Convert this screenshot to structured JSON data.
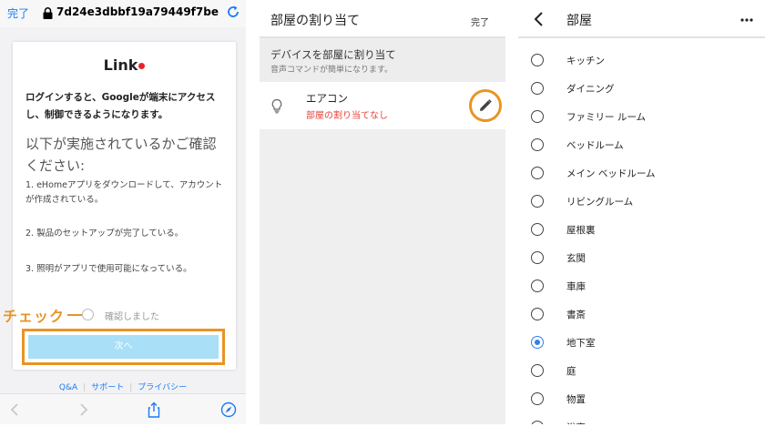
{
  "browser": {
    "done_label": "完了",
    "url": "7d24e3dbbf19a79449f7beaf9",
    "card": {
      "logo_text": "Link",
      "intro": "ログインすると、Googleが端末にアクセスし、制御できるようになります。",
      "confirm_heading": "以下が実施されているかご確認ください:",
      "items": [
        "1. eHomeアプリをダウンロードして、アカウントが作成されている。",
        "2. 製品のセットアップが完了している。",
        "3. 照明がアプリで使用可能になっている。"
      ],
      "checkbox_label": "確認しました",
      "next_label": "次へ"
    },
    "footer_links": [
      "Q&A",
      "サポート",
      "プライバシー"
    ],
    "annotation": "チェック"
  },
  "room_assign": {
    "title": "部屋の割り当て",
    "done_label": "完了",
    "section_title": "デバイスを部屋に割り当て",
    "section_subtitle": "音声コマンドが簡単になります。",
    "device": {
      "name": "エアコン",
      "status": "部屋の割り当てなし"
    }
  },
  "rooms": {
    "title": "部屋",
    "items": [
      {
        "label": "キッチン",
        "selected": false
      },
      {
        "label": "ダイニング",
        "selected": false
      },
      {
        "label": "ファミリー ルーム",
        "selected": false
      },
      {
        "label": "ベッドルーム",
        "selected": false
      },
      {
        "label": "メイン ベッドルーム",
        "selected": false
      },
      {
        "label": "リビングルーム",
        "selected": false
      },
      {
        "label": "屋根裏",
        "selected": false
      },
      {
        "label": "玄関",
        "selected": false
      },
      {
        "label": "車庫",
        "selected": false
      },
      {
        "label": "書斎",
        "selected": false
      },
      {
        "label": "地下室",
        "selected": true
      },
      {
        "label": "庭",
        "selected": false
      },
      {
        "label": "物置",
        "selected": false
      },
      {
        "label": "浴室",
        "selected": false
      }
    ]
  },
  "colors": {
    "accent_blue": "#1a7cf5",
    "highlight_orange": "#e89524",
    "warning_red": "#e8433b",
    "button_light_blue": "#a9dff7",
    "radio_selected": "#2f80ed"
  }
}
